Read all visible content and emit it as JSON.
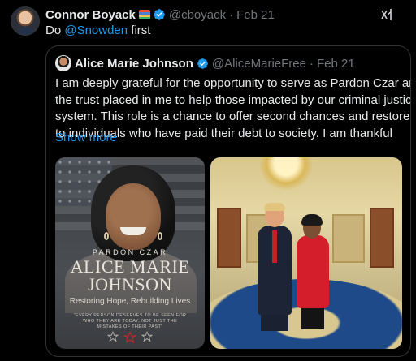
{
  "tweet": {
    "author_name": "Connor Boyack",
    "author_handle": "@cboyack",
    "separator": "·",
    "date": "Feb 21",
    "text_prefix": "Do ",
    "mention": "@Snowden",
    "text_suffix": " first"
  },
  "quoted": {
    "author_name": "Alice Marie Johnson",
    "author_handle": "@AliceMarieFree",
    "separator": "·",
    "date": "Feb 21",
    "body_lines": [
      "I am deeply grateful for the opportunity to serve as Pardon Czar and for",
      "the trust placed in me to help those impacted by our criminal justice",
      "system. This role is a chance to offer second chances and restore hope",
      "to individuals who have paid their debt to society. I am thankful"
    ],
    "show_more": "Show more",
    "image1": {
      "subtitle": "PARDON CZAR",
      "name_line1": "ALICE MARIE",
      "name_line2": "JOHNSON",
      "tagline": "Restoring Hope, Rebuilding Lives",
      "quote": "\"EVERY PERSON DESERVES TO BE SEEN FOR WHO THEY ARE TODAY, NOT JUST THE MISTAKES OF THEIR PAST\""
    }
  },
  "colors": {
    "background": "#000000",
    "text": "#e7e9ea",
    "muted": "#71767b",
    "link": "#1d9bf0",
    "verified": "#1d9bf0",
    "border": "#2f3336"
  },
  "icons": [
    "verified-badge-icon",
    "grok-icon",
    "star-icon"
  ]
}
